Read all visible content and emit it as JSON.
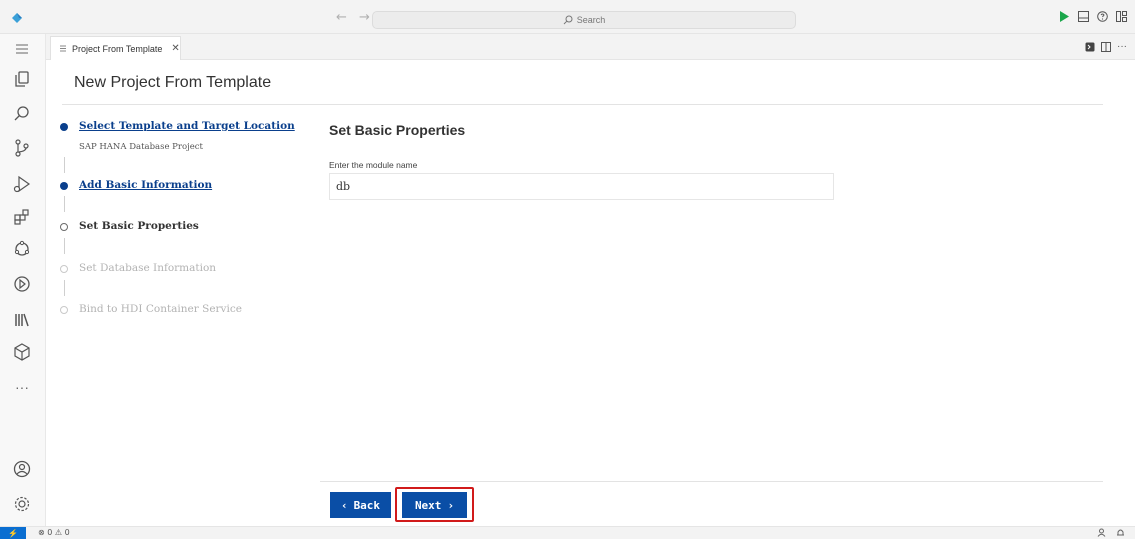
{
  "titlebar": {
    "back_arrow": "←",
    "forward_arrow": "→",
    "search_placeholder": "Search",
    "icons": [
      "run-icon",
      "panel-icon",
      "help-icon",
      "layout-icon"
    ]
  },
  "tabs": [
    {
      "label": "Project From Template",
      "close": "✕"
    }
  ],
  "page": {
    "title": "New Project From Template"
  },
  "steps": [
    {
      "label": "Select Template and Target Location",
      "sub": "SAP HANA Database Project",
      "state": "done"
    },
    {
      "label": "Add Basic Information",
      "sub": "",
      "state": "done"
    },
    {
      "label": "Set Basic Properties",
      "sub": "",
      "state": "current"
    },
    {
      "label": "Set Database Information",
      "sub": "",
      "state": "disabled"
    },
    {
      "label": "Bind to HDI Container Service",
      "sub": "",
      "state": "disabled"
    }
  ],
  "form": {
    "section_title": "Set Basic Properties",
    "module_label": "Enter the module name",
    "module_value": "db"
  },
  "buttons": {
    "back": "Back",
    "back_chevron": "‹",
    "next": "Next",
    "next_chevron": "›"
  },
  "statusbar": {
    "remote": "⚡",
    "errors": "0",
    "warnings": "0"
  },
  "colors": {
    "accent": "#0a4ea6",
    "link": "#0a3f8c",
    "highlight": "#d11a1a",
    "run": "#1aa64a"
  },
  "tabbar_more": "···",
  "activity_more": "···"
}
